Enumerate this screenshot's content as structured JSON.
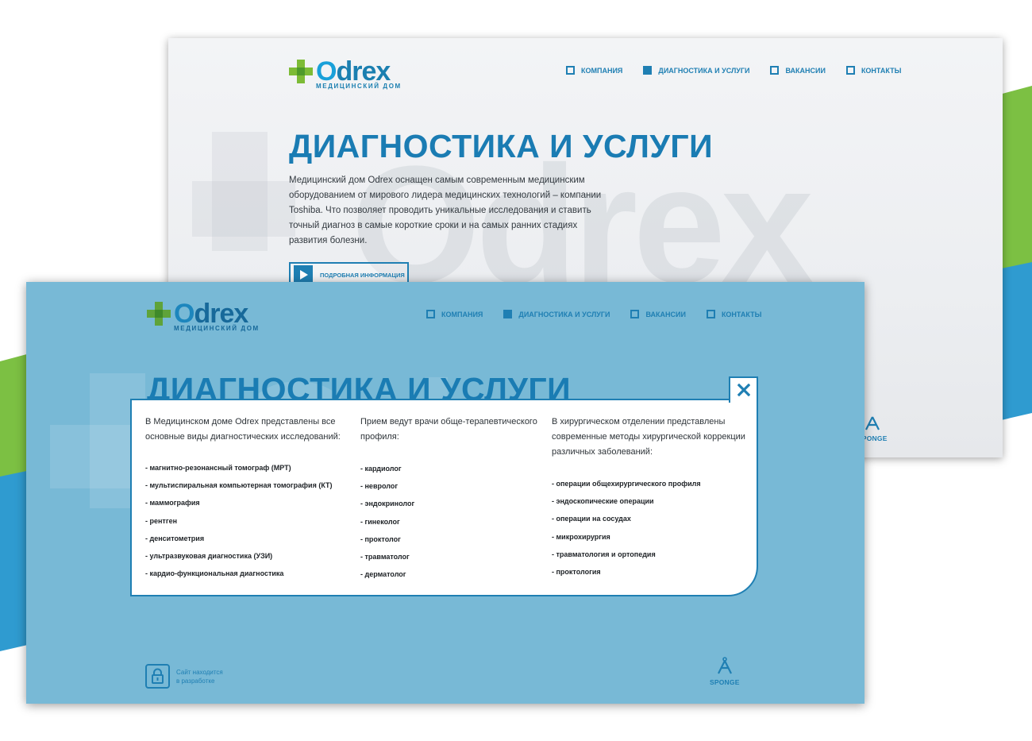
{
  "brand": {
    "name": "Odrex",
    "name_o": "O",
    "name_rest": "drex",
    "tagline": "медицинский дом"
  },
  "nav": {
    "items": [
      {
        "label": "КОМПАНИЯ",
        "active": false
      },
      {
        "label": "ДИАГНОСТИКА И УСЛУГИ",
        "active": true
      },
      {
        "label": "ВАКАНСИИ",
        "active": false
      },
      {
        "label": "КОНТАКТЫ",
        "active": false
      }
    ]
  },
  "hero": {
    "title": "ДИАГНОСТИКА И УСЛУГИ",
    "text": "Медицинский дом Odrex оснащен самым современным медицинским оборудованием от мирового лидера медицинских технологий – компании Toshiba. Что позволяет проводить уникальные исследования и ставить точный диагноз в самые короткие сроки и на самых ранних стадиях развития болезни.",
    "more_button": "ПОДРОБНАЯ ИНФОРМАЦИЯ"
  },
  "modal": {
    "columns": [
      {
        "intro": "В Медицинском доме Odrex представлены все основные виды диагностических исследований:",
        "items": [
          "- магнитно-резонансный томограф (МРТ)",
          "- мультиспиральная компьютерная  томография (КТ)",
          "- маммография",
          "- рентген",
          "- денситометрия",
          "- ультразвуковая диагностика (УЗИ)",
          "- кардио-функциональная диагностика"
        ]
      },
      {
        "intro": "Прием ведут врачи обще-терапевтического профиля:",
        "items": [
          "- кардиолог",
          "- невролог",
          "- эндокринолог",
          "- гинеколог",
          "- проктолог",
          "- травматолог",
          "- дерматолог"
        ]
      },
      {
        "intro": "В хирургическом отделении представлены современные методы хирургической коррекции различных заболеваний:",
        "items": [
          "- операции общехирургического профиля",
          "- эндоскопические операции",
          "- операции на сосудах",
          "- микрохирургия",
          "- травматология и ортопедия",
          "- проктология"
        ]
      }
    ]
  },
  "footer": {
    "dev_line1": "Сайт находится",
    "dev_line2": "в разработке",
    "studio": "SPONGE"
  },
  "colors": {
    "brand_blue": "#1f7fb3",
    "brand_green": "#7dbb36",
    "overlay_blue": "#78b9d6"
  }
}
